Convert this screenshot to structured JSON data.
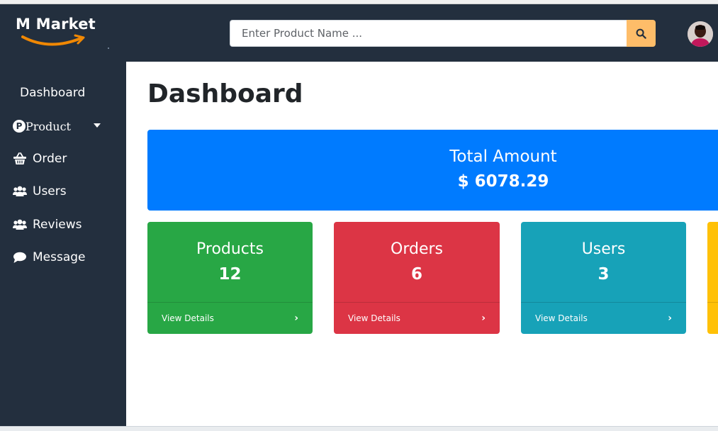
{
  "header": {
    "logo_text": "M Market",
    "search_placeholder": "Enter Product Name ...",
    "search_value": "",
    "search_button_icon": "search-icon",
    "accent_color": "#febd69",
    "background_color": "#232f3e"
  },
  "sidebar": {
    "items": [
      {
        "label": "Dashboard",
        "icon": "none"
      },
      {
        "label": "Product",
        "icon": "product-badge-icon",
        "has_dropdown": true
      },
      {
        "label": "Order",
        "icon": "basket-icon"
      },
      {
        "label": "Users",
        "icon": "users-icon"
      },
      {
        "label": "Reviews",
        "icon": "users-icon"
      },
      {
        "label": "Message",
        "icon": "comment-icon"
      }
    ],
    "product_badge_letter": "P"
  },
  "main": {
    "title": "Dashboard",
    "total": {
      "label": "Total Amount",
      "value": "$ 6078.29",
      "color": "#007bff"
    },
    "cards": [
      {
        "title": "Products",
        "value": "12",
        "link": "View Details",
        "color": "#28a745"
      },
      {
        "title": "Orders",
        "value": "6",
        "link": "View Details",
        "color": "#dc3545"
      },
      {
        "title": "Users",
        "value": "3",
        "link": "View Details",
        "color": "#17a2b8"
      },
      {
        "title": "",
        "value": "",
        "link": "",
        "color": "#ffc107"
      }
    ]
  }
}
